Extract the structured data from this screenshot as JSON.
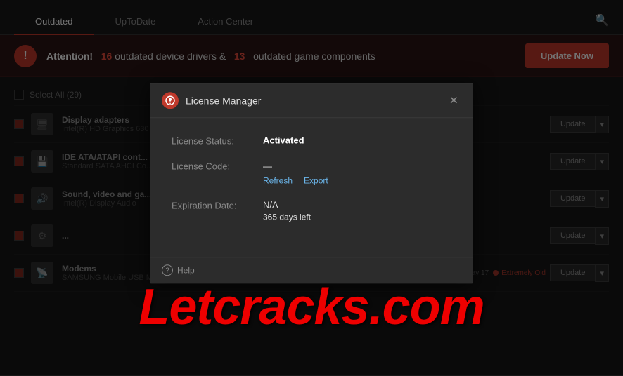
{
  "nav": {
    "tabs": [
      {
        "label": "Outdated",
        "active": true
      },
      {
        "label": "UpToDate",
        "active": false
      },
      {
        "label": "Action Center",
        "active": false
      }
    ],
    "search_icon": "🔍"
  },
  "attention": {
    "title": "Attention!",
    "outdated_drivers": "16",
    "outdated_components": "13",
    "message_mid": "outdated device drivers &",
    "message_end": "outdated game components",
    "update_btn_label": "Update Now"
  },
  "device_list": {
    "select_all": "Select All (29)",
    "items": [
      {
        "name": "Display adapters",
        "sub": "Intel(R) HD Graphics 630",
        "update_label": "Update"
      },
      {
        "name": "IDE ATA/ATAPI cont...",
        "sub": "Standard SATA AHCI Co...",
        "update_label": "Update"
      },
      {
        "name": "Sound, video and ga...",
        "sub": "Intel(R) Display Audio",
        "update_label": "Update"
      },
      {
        "name": "...",
        "sub": "",
        "update_label": "Update"
      },
      {
        "name": "Modems",
        "sub": "SAMSUNG Mobile USB Modem",
        "available": "Available: 13 May 17",
        "status": "Extremely Old",
        "update_label": "Update"
      }
    ]
  },
  "modal": {
    "title": "License Manager",
    "icon_label": "LM",
    "close_icon": "✕",
    "license_status_label": "License Status:",
    "license_status_value": "Activated",
    "license_code_label": "License Code:",
    "license_code_dashes": "—",
    "refresh_label": "Refresh",
    "export_label": "Export",
    "expiration_label": "Expiration Date:",
    "expiration_value": "N/A",
    "days_left": "365 days left",
    "help_label": "Help"
  },
  "watermark": {
    "text": "Letcracks.com"
  }
}
